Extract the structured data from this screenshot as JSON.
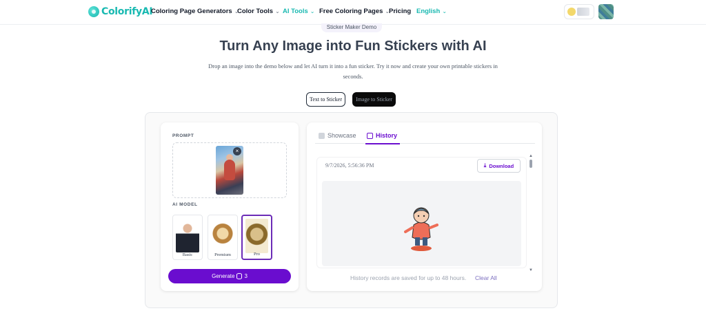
{
  "nav": {
    "logo_text": "ColorifyAI",
    "items": [
      {
        "label": "Coloring Page Generators",
        "has_dropdown": true
      },
      {
        "label": "Color Tools",
        "has_dropdown": true
      },
      {
        "label": "AI Tools",
        "has_dropdown": true
      },
      {
        "label": "Free Coloring Pages",
        "has_dropdown": true
      },
      {
        "label": "Pricing",
        "has_dropdown": false
      },
      {
        "label": "English",
        "has_dropdown": true
      }
    ],
    "chevron": "⌄"
  },
  "hero": {
    "badge": "Sticker Maker Demo",
    "title": "Turn Any Image into Fun Stickers with AI",
    "subtitle": "Drop an image into the demo below and let AI turn it into a fun sticker. Try it now and create your own printable stickers in seconds.",
    "modes": [
      "Text to Sticker",
      "Image to Sticker"
    ]
  },
  "left_panel": {
    "prompt_label": "PROMPT",
    "model_label": "AI MODEL",
    "close_glyph": "×",
    "models": [
      {
        "name": "Basic",
        "selected": false
      },
      {
        "name": "Premium",
        "selected": false
      },
      {
        "name": "Pro",
        "selected": true
      }
    ],
    "generate_label": "Generate",
    "generate_cost": "3"
  },
  "right_panel": {
    "tabs": [
      {
        "label": "Showcase",
        "active": false,
        "icon": "showcase-icon"
      },
      {
        "label": "History",
        "active": true,
        "icon": "history-icon"
      }
    ],
    "record": {
      "timestamp": "9/7/2026, 5:56:36 PM",
      "download_label": "Download"
    },
    "footnote": "History records are saved for up to 48 hours.",
    "clear_all": "Clear All"
  },
  "colors": {
    "brand_teal": "#19b9b1",
    "accent_purple": "#6a0dcf"
  }
}
